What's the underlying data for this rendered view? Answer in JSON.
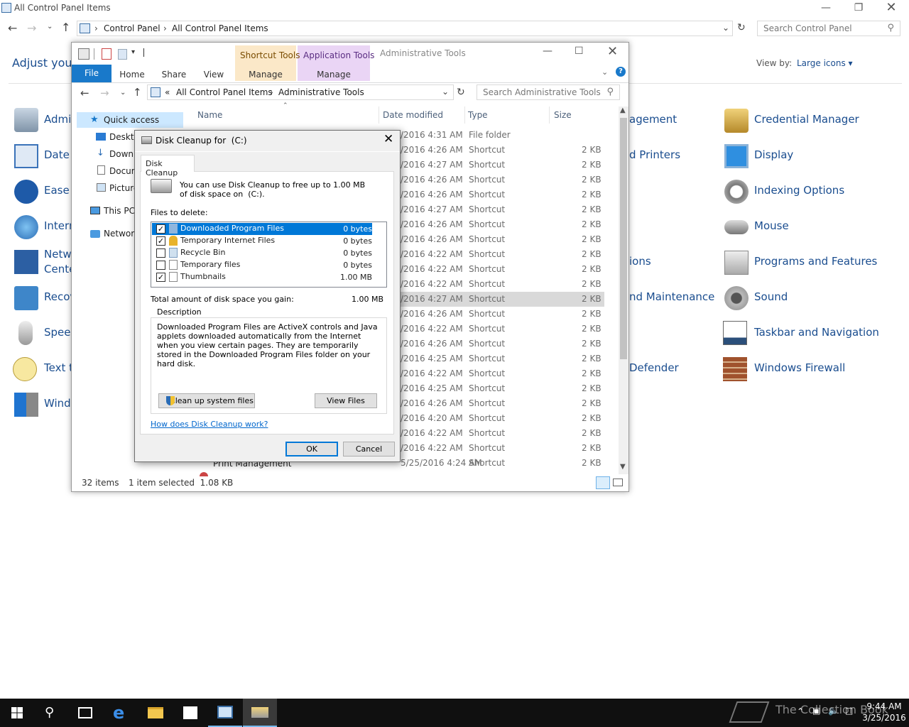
{
  "cp": {
    "title": "All Control Panel Items",
    "breadcrumb": [
      "Control Panel",
      "All Control Panel Items"
    ],
    "search_placeholder": "Search Control Panel",
    "adjust": "Adjust your",
    "view_by_label": "View by:",
    "view_by_value": "Large icons",
    "items_left": [
      "Admi",
      "Date a",
      "Ease c",
      "Intern",
      "Netwo",
      "Cente",
      "Recov",
      "Speec",
      "Text to",
      "Windo"
    ],
    "items_middle": [
      "agement",
      "d Printers",
      "ions",
      "nd Maintenance",
      "Defender"
    ],
    "items_right": [
      "Credential Manager",
      "Display",
      "Indexing Options",
      "Mouse",
      "Programs and Features",
      "Sound",
      "Taskbar and Navigation",
      "Windows Firewall"
    ]
  },
  "explorer": {
    "title": "Administrative Tools",
    "ctx_shortcut": "Shortcut Tools",
    "ctx_application": "Application Tools",
    "tab_file": "File",
    "tab_home": "Home",
    "tab_share": "Share",
    "tab_view": "View",
    "tab_manage1": "Manage",
    "tab_manage2": "Manage",
    "address": {
      "prefix": "«",
      "part1": "All Control Panel Items",
      "part2": "Administrative Tools"
    },
    "search_placeholder": "Search Administrative Tools",
    "columns": {
      "name": "Name",
      "date": "Date modified",
      "type": "Type",
      "size": "Size"
    },
    "nav": [
      "Quick access",
      "Deskto",
      "Downl",
      "Docum",
      "Picture",
      "This PC",
      "Network"
    ],
    "rows": [
      {
        "date": "/2016 4:31 AM",
        "type": "File folder",
        "size": ""
      },
      {
        "date": "/2016 4:26 AM",
        "type": "Shortcut",
        "size": "2 KB"
      },
      {
        "date": "/2016 4:27 AM",
        "type": "Shortcut",
        "size": "2 KB"
      },
      {
        "date": "/2016 4:26 AM",
        "type": "Shortcut",
        "size": "2 KB"
      },
      {
        "date": "/2016 4:26 AM",
        "type": "Shortcut",
        "size": "2 KB"
      },
      {
        "date": "/2016 4:27 AM",
        "type": "Shortcut",
        "size": "2 KB"
      },
      {
        "date": "/2016 4:26 AM",
        "type": "Shortcut",
        "size": "2 KB"
      },
      {
        "date": "/2016 4:26 AM",
        "type": "Shortcut",
        "size": "2 KB"
      },
      {
        "date": "/2016 4:22 AM",
        "type": "Shortcut",
        "size": "2 KB"
      },
      {
        "date": "/2016 4:22 AM",
        "type": "Shortcut",
        "size": "2 KB"
      },
      {
        "date": "/2016 4:22 AM",
        "type": "Shortcut",
        "size": "2 KB"
      },
      {
        "date": "/2016 4:27 AM",
        "type": "Shortcut",
        "size": "2 KB"
      },
      {
        "date": "/2016 4:26 AM",
        "type": "Shortcut",
        "size": "2 KB"
      },
      {
        "date": "/2016 4:22 AM",
        "type": "Shortcut",
        "size": "2 KB"
      },
      {
        "date": "/2016 4:26 AM",
        "type": "Shortcut",
        "size": "2 KB"
      },
      {
        "date": "/2016 4:25 AM",
        "type": "Shortcut",
        "size": "2 KB"
      },
      {
        "date": "/2016 4:22 AM",
        "type": "Shortcut",
        "size": "2 KB"
      },
      {
        "date": "/2016 4:25 AM",
        "type": "Shortcut",
        "size": "2 KB"
      },
      {
        "date": "/2016 4:26 AM",
        "type": "Shortcut",
        "size": "2 KB"
      },
      {
        "date": "/2016 4:20 AM",
        "type": "Shortcut",
        "size": "2 KB"
      },
      {
        "date": "/2016 4:22 AM",
        "type": "Shortcut",
        "size": "2 KB"
      },
      {
        "date": "/2016 4:22 AM",
        "type": "Shortcut",
        "size": "2 KB"
      },
      {
        "date": "5/25/2016 4:24 AM",
        "type": "Shortcut",
        "size": "2 KB"
      }
    ],
    "last_row_name": "Print Management",
    "status_items": "32 items",
    "status_selected": "1 item selected  1.08 KB"
  },
  "dialog": {
    "title": "Disk Cleanup for  (C:)",
    "tab": "Disk Cleanup",
    "intro": "You can use Disk Cleanup to free up to 1.00 MB of disk space on  (C:).",
    "files_label": "Files to delete:",
    "files": [
      {
        "name": "Downloaded Program Files",
        "size": "0 bytes",
        "checked": "✓"
      },
      {
        "name": "Temporary Internet Files",
        "size": "0 bytes",
        "checked": "✓"
      },
      {
        "name": "Recycle Bin",
        "size": "0 bytes",
        "checked": ""
      },
      {
        "name": "Temporary files",
        "size": "0 bytes",
        "checked": ""
      },
      {
        "name": "Thumbnails",
        "size": "1.00 MB",
        "checked": "✓"
      }
    ],
    "total_label": "Total amount of disk space you gain:",
    "total_value": "1.00 MB",
    "desc_title": "Description",
    "description": "Downloaded Program Files are ActiveX controls and Java applets downloaded automatically from the Internet when you view certain pages. They are temporarily stored in the Downloaded Program Files folder on your hard disk.",
    "cleanup_system": "Clean up system files",
    "view_files": "View Files",
    "how_link": "How does Disk Cleanup work?",
    "ok": "OK",
    "cancel": "Cancel"
  },
  "taskbar": {
    "time": "9:44 AM",
    "date": "3/25/2016",
    "watermark": "The Collection Book"
  },
  "colors": {
    "accent": "#0078d7",
    "link": "#1a4d8f",
    "taskbar": "#101010"
  }
}
